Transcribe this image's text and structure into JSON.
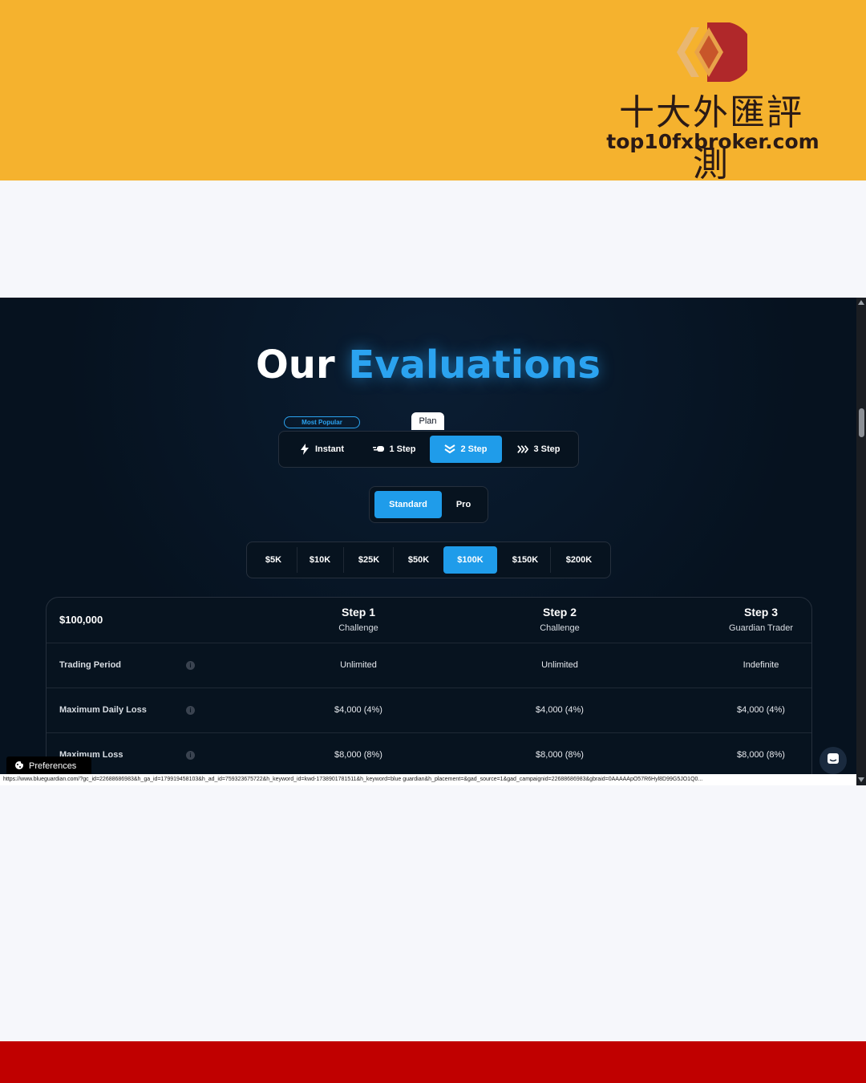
{
  "watermark": {
    "cn_text": "十大外匯評測",
    "url": "top10fxbroker.com",
    "colors": {
      "banner": "#f5b22e",
      "bottom_bar": "#c00000"
    }
  },
  "page": {
    "heading_part1": "Our",
    "heading_part2": "Evaluations",
    "accent_color": "#2ba3f0",
    "most_popular": "Most Popular",
    "plan_label": "Plan"
  },
  "plan_tabs": [
    {
      "label": "Instant",
      "icon": "lightning-icon",
      "active": false
    },
    {
      "label": "1 Step",
      "icon": "fast-forward-icon",
      "active": false
    },
    {
      "label": "2 Step",
      "icon": "double-chevron-down-icon",
      "active": true
    },
    {
      "label": "3 Step",
      "icon": "triple-chevron-right-icon",
      "active": false
    }
  ],
  "tier_tabs": [
    {
      "label": "Standard",
      "active": true
    },
    {
      "label": "Pro",
      "active": false
    }
  ],
  "amount_tabs": [
    {
      "label": "$5K",
      "active": false
    },
    {
      "label": "$10K",
      "active": false
    },
    {
      "label": "$25K",
      "active": false
    },
    {
      "label": "$50K",
      "active": false
    },
    {
      "label": "$100K",
      "active": true
    },
    {
      "label": "$150K",
      "active": false
    },
    {
      "label": "$200K",
      "active": false
    }
  ],
  "table": {
    "account_size": "$100,000",
    "columns": [
      {
        "title": "Step 1",
        "subtitle": "Challenge"
      },
      {
        "title": "Step 2",
        "subtitle": "Challenge"
      },
      {
        "title": "Step 3",
        "subtitle": "Guardian Trader"
      }
    ],
    "rows": [
      {
        "label": "Trading Period",
        "values": [
          "Unlimited",
          "Unlimited",
          "Indefinite"
        ]
      },
      {
        "label": "Maximum Daily Loss",
        "values": [
          "$4,000 (4%)",
          "$4,000 (4%)",
          "$4,000 (4%)"
        ]
      },
      {
        "label": "Maximum Loss",
        "values": [
          "$8,000 (8%)",
          "$8,000 (8%)",
          "$8,000 (8%)"
        ]
      }
    ]
  },
  "preferences_label": "Preferences",
  "status_url": "https://www.blueguardian.com/?gc_id=22688686983&h_ga_id=179919458103&h_ad_id=759323675722&h_keyword_id=kwd-1738901781511&h_keyword=blue guardian&h_placement=&gad_source=1&gad_campaignid=22688686983&gbraid=0AAAAApO57R6Hyl8D99G5JO1Q0..."
}
